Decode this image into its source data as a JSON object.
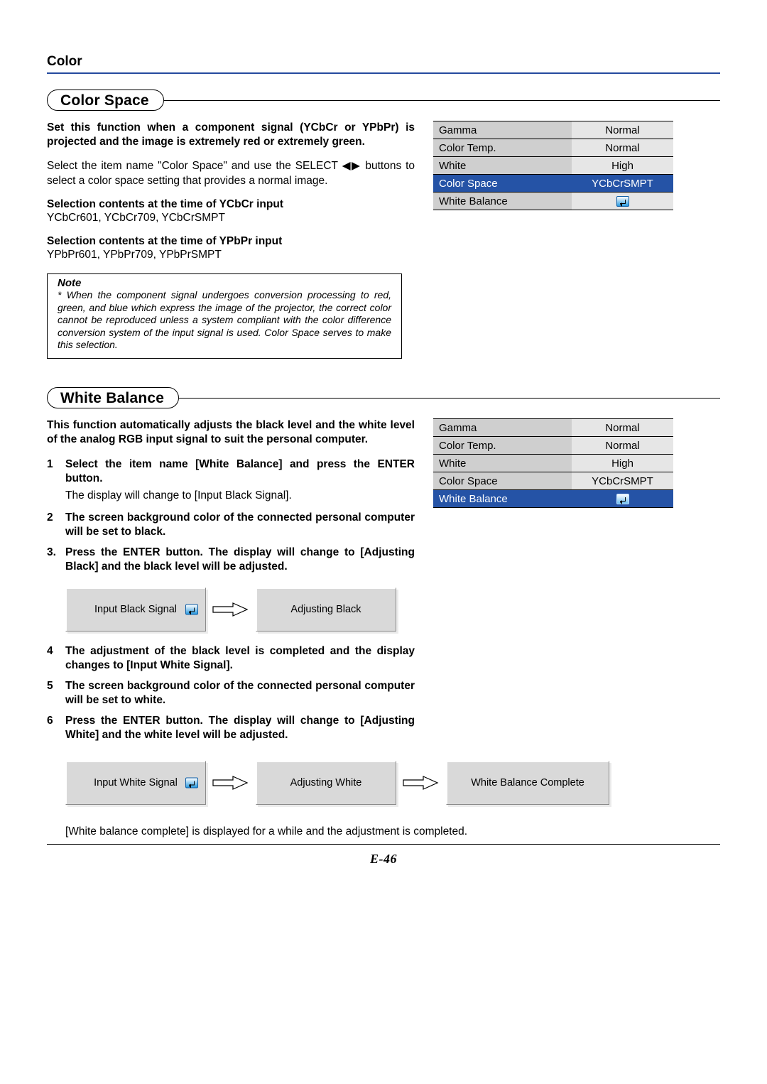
{
  "page_title": "Color",
  "page_number": "E-46",
  "section1": {
    "heading": "Color Space",
    "intro": "Set this function when a component signal (YCbCr or YPbPr) is projected and the image is extremely red or extremely green.",
    "body_pre": "Select the item name \"Color Space\" and use the SELECT ",
    "body_arrows": "◀▶",
    "body_post": " buttons to select a color space setting that provides a normal image.",
    "sel1_hdr": "Selection contents at the time of YCbCr input",
    "sel1_list": "YCbCr601, YCbCr709, YCbCrSMPT",
    "sel2_hdr": "Selection contents at the time of YPbPr input",
    "sel2_list": "YPbPr601, YPbPr709, YPbPrSMPT",
    "note_title": "Note",
    "note_text": "When the component signal undergoes conversion processing to red, green, and blue which express the image of the projector, the correct color cannot be reproduced unless a system compliant with the color difference conversion system of the input signal is used. Color Space serves to make this selection."
  },
  "menu1": {
    "rows": [
      {
        "label": "Gamma",
        "value": "Normal",
        "selected": false,
        "icon": false
      },
      {
        "label": "Color Temp.",
        "value": "Normal",
        "selected": false,
        "icon": false
      },
      {
        "label": "White",
        "value": "High",
        "selected": false,
        "icon": false
      },
      {
        "label": "Color Space",
        "value": "YCbCrSMPT",
        "selected": true,
        "icon": false
      },
      {
        "label": "White Balance",
        "value": "",
        "selected": false,
        "icon": true
      }
    ]
  },
  "section2": {
    "heading": "White Balance",
    "intro": "This function automatically adjusts the black level and the white level of the analog RGB input signal to suit the personal computer.",
    "steps": [
      {
        "n": "1",
        "bold": true,
        "text": "Select the item name [White Balance] and press the ENTER button."
      },
      {
        "n": "",
        "bold": false,
        "text": "The display will change to [Input Black Signal]."
      },
      {
        "n": "2",
        "bold": true,
        "text": "The screen background color of the connected personal computer will be set to black."
      },
      {
        "n": "3.",
        "bold": true,
        "text": "Press the ENTER button. The display will change to [Adjusting Black] and the black level will be adjusted."
      }
    ],
    "flow1": {
      "a": "Input Black Signal",
      "b": "Adjusting Black"
    },
    "steps2": [
      {
        "n": "4",
        "bold": true,
        "text": "The adjustment of the black level is completed and the display changes to [Input White Signal]."
      },
      {
        "n": "5",
        "bold": true,
        "text": "The screen background color of the connected personal computer will be set to white."
      },
      {
        "n": "6",
        "bold": true,
        "text": "Press the ENTER button. The display will change to [Adjusting White] and the white level will be adjusted."
      }
    ],
    "flow2": {
      "a": "Input White Signal",
      "b": "Adjusting White",
      "c": "White Balance Complete"
    },
    "tail": "[White balance complete] is displayed for a while and the adjustment is completed."
  },
  "menu2": {
    "rows": [
      {
        "label": "Gamma",
        "value": "Normal",
        "selected": false,
        "icon": false
      },
      {
        "label": "Color Temp.",
        "value": "Normal",
        "selected": false,
        "icon": false
      },
      {
        "label": "White",
        "value": "High",
        "selected": false,
        "icon": false
      },
      {
        "label": "Color Space",
        "value": "YCbCrSMPT",
        "selected": false,
        "icon": false
      },
      {
        "label": "White Balance",
        "value": "",
        "selected": true,
        "icon": true
      }
    ]
  }
}
